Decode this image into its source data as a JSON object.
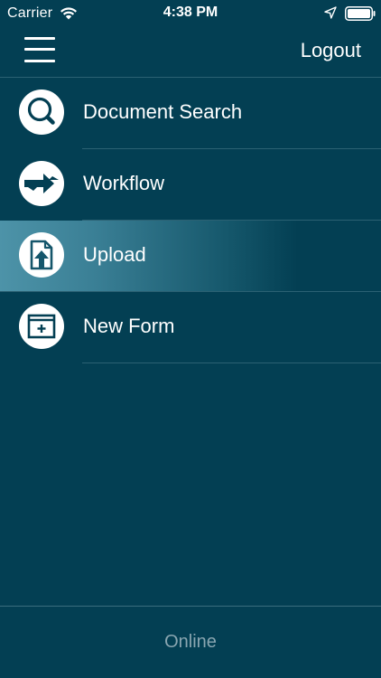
{
  "status_bar": {
    "carrier": "Carrier",
    "time": "4:38 PM",
    "wifi_icon": "wifi-icon",
    "location_icon": "location-arrow-icon",
    "battery_icon": "battery-icon"
  },
  "nav": {
    "menu_icon": "hamburger-menu-icon",
    "logout_label": "Logout"
  },
  "menu": {
    "items": [
      {
        "label": "Document Search",
        "icon": "magnifier-icon",
        "active": false
      },
      {
        "label": "Workflow",
        "icon": "workflow-arrows-icon",
        "active": false
      },
      {
        "label": "Upload",
        "icon": "upload-document-icon",
        "active": true
      },
      {
        "label": "New Form",
        "icon": "new-form-icon",
        "active": false
      }
    ]
  },
  "footer": {
    "connection_status": "Online"
  },
  "colors": {
    "background": "#033f53",
    "active_highlight": "#4d93a8",
    "divider": "#2b6173",
    "footer_text": "#8aa6b1",
    "text": "#ffffff"
  }
}
